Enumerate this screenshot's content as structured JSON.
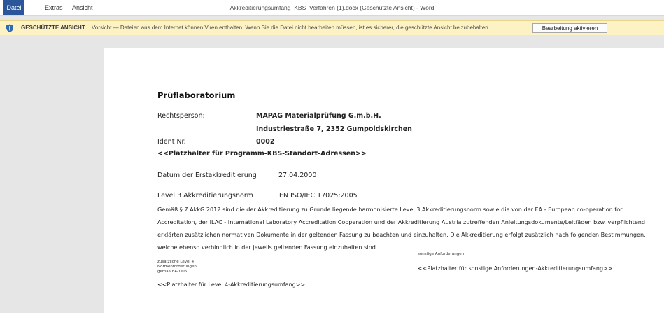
{
  "menu": {
    "file": "Datei",
    "extras": "Extras",
    "view": "Ansicht"
  },
  "window_title": "Akkreditierungsumfang_KBS_Verfahren (1).docx (Geschützte Ansicht) - Word",
  "protected_view": {
    "label": "GESCHÜTZTE ANSICHT",
    "message": "Vorsicht — Dateien aus dem Internet können Viren enthalten. Wenn Sie die Datei nicht bearbeiten müssen, ist es sicherer, die geschützte Ansicht beizubehalten.",
    "button": "Bearbeitung aktivieren"
  },
  "document": {
    "heading": "Prüflaboratorium",
    "legal_person_label": "Rechtsperson:",
    "legal_person_name": "MAPAG Materialprüfung G.m.b.H.",
    "legal_person_address": "Industriestraße 7, 2352 Gumpoldskirchen",
    "ident_label": "Ident Nr.",
    "ident_value": "0002",
    "placeholder_sites": "<<Platzhalter für Programm-KBS-Standort-Adressen>>",
    "first_accreditation_label": "Datum der Erstakkreditierung",
    "first_accreditation_date": "27.04.2000",
    "level3_label": "Level 3 Akkreditierungsnorm",
    "level3_value": "EN ISO/IEC 17025:2005",
    "paragraph": "Gemäß § 7 AkkG 2012 sind die der Akkreditierung zu Grunde liegende harmonisierte Level 3 Akkreditierungsnorm sowie die von der EA - European co-operation for Accreditation, der ILAC - International Laboratory Accreditation Cooperation und der Akkreditierung Austria zutreffenden Anleitungsdokumente/Leitfäden bzw. verpflichtend erklärten zusätzlichen normativen Dokumente in der geltenden Fassung zu beachten und einzuhalten. Die Akkreditierung erfolgt zusätzlich nach folgenden Bestimmungen, welche ebenso verbindlich in der jeweils geltenden Fassung einzuhalten sind.",
    "level4_line1": "zusätzliche Level 4",
    "level4_line2": "Normenforderungen",
    "level4_line3": "gemäß EA-1/06",
    "level4_placeholder": "<<Platzhalter für Level 4-Akkreditierungsumfang>>",
    "other_label": "sonstige Anforderungen",
    "other_placeholder": "<<Platzhalter für sonstige Anforderungen-Akkreditierungsumfang>>"
  },
  "colors": {
    "accent": "#2b579a",
    "infobar": "#fdf2c4",
    "shield": "#2f6bb3"
  }
}
